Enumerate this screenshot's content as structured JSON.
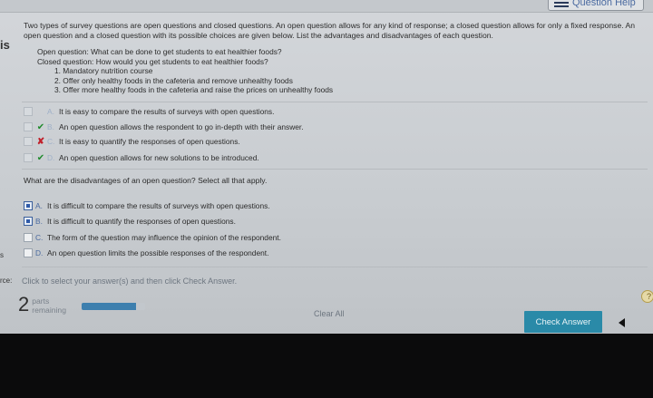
{
  "header": {
    "help_label": "Question Help"
  },
  "left_edge": {
    "label_top": "is",
    "label_mid": "s",
    "label_low": "rce:"
  },
  "question": {
    "intro": "Two types of survey questions are open questions and closed questions. An open question allows for any kind of response; a closed question allows for only a fixed response. An open question and a closed question with its possible choices are given below. List the advantages and disadvantages of each question.",
    "open_q": "Open question: What can be done to get students to eat healthier foods?",
    "closed_q": "Closed question: How would you get students to eat healthier foods?",
    "closed_choices": [
      "1. Mandatory nutrition course",
      "2. Offer only healthy foods in the cafeteria and remove unhealthy foods",
      "3. Offer more healthy foods in the cafeteria and raise the prices on unhealthy foods"
    ]
  },
  "part1": {
    "options": [
      {
        "letter": "A.",
        "text": "It is easy to compare the results of surveys with open questions.",
        "mark": ""
      },
      {
        "letter": "B.",
        "text": "An open question allows the respondent to go in-depth with their answer.",
        "mark": "✔"
      },
      {
        "letter": "C.",
        "text": "It is easy to quantify the responses of open questions.",
        "mark": "✘"
      },
      {
        "letter": "D.",
        "text": "An open question allows for new solutions to be introduced.",
        "mark": "✔"
      }
    ]
  },
  "part2": {
    "prompt": "What are the disadvantages of an open question? Select all that apply.",
    "options": [
      {
        "letter": "A.",
        "text": "It is difficult to compare the results of surveys with open questions.",
        "checked": true
      },
      {
        "letter": "B.",
        "text": "It is difficult to quantify the responses of open questions.",
        "checked": true
      },
      {
        "letter": "C.",
        "text": "The form of the question may influence the opinion of the respondent.",
        "checked": false
      },
      {
        "letter": "D.",
        "text": "An open question limits the possible responses of the respondent.",
        "checked": false
      }
    ]
  },
  "footer": {
    "hint": "Click to select your answer(s) and then click Check Answer.",
    "parts_count": "2",
    "parts_label_1": "parts",
    "parts_label_2": "remaining",
    "progress_fraction": 0.85,
    "clear_label": "Clear All",
    "check_label": "Check Answer",
    "help_glyph": "?"
  },
  "colors": {
    "accent": "#2a8aa8",
    "progress": "#3d7fae",
    "correct": "#1f8a2c",
    "incorrect": "#c0202a"
  }
}
